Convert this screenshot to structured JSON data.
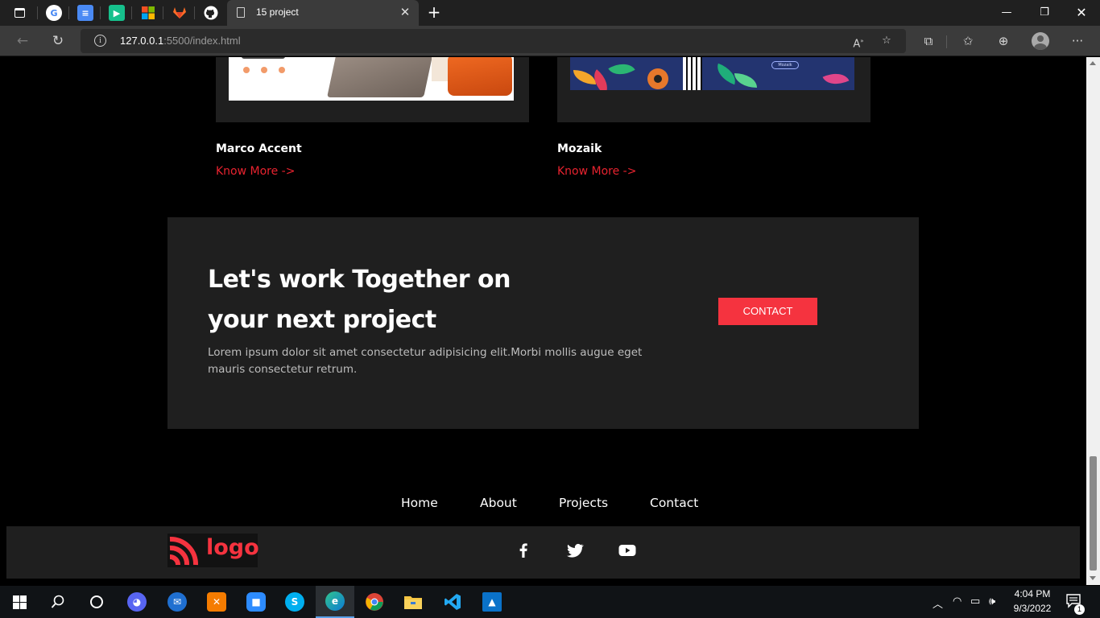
{
  "browser": {
    "tab_title": "15 project",
    "url_host": "127.0.0.1",
    "url_rest": ":5500/index.html",
    "pinned_tabs": [
      "google-icon",
      "docs-icon",
      "play-icon",
      "microsoft-icon",
      "gitlab-icon",
      "github-icon"
    ]
  },
  "projects": [
    {
      "title": "Marco Accent",
      "link": "Know More ->"
    },
    {
      "title": "Mozaik",
      "link": "Know More ->"
    }
  ],
  "cta": {
    "heading_line1": "Let's work Together on",
    "heading_line2": "your next project",
    "body": "Lorem ipsum dolor sit amet consectetur adipisicing elit.Morbi mollis augue eget mauris consectetur retrum.",
    "button": "CONTACT"
  },
  "footer_nav": [
    "Home",
    "About",
    "Projects",
    "Contact"
  ],
  "footer": {
    "logo_text": "logo",
    "social": [
      "facebook-icon",
      "twitter-icon",
      "youtube-icon"
    ]
  },
  "mozaik_thumb_tag": "Mozaik",
  "taskbar": {
    "time": "4:04 PM",
    "date": "9/3/2022",
    "notification_count": "1"
  },
  "colors": {
    "accent": "#f5333f",
    "link": "#e8232f",
    "panel": "#1f1f1f",
    "page_bg": "#000000"
  }
}
